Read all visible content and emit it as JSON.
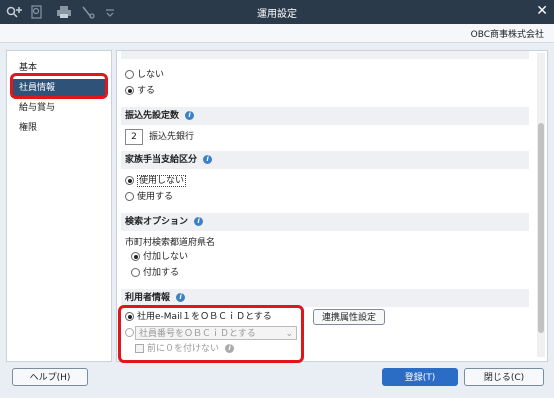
{
  "window": {
    "title": "運用設定",
    "close_glyph": "✕"
  },
  "company": "OBC商事株式会社",
  "sidebar": {
    "items": [
      {
        "label": "基本"
      },
      {
        "label": "社員情報"
      },
      {
        "label": "給与賞与"
      },
      {
        "label": "権限"
      }
    ]
  },
  "sections": {
    "auto": {
      "options": [
        "しない",
        "する"
      ],
      "selected": "する"
    },
    "transfer": {
      "title": "振込先設定数",
      "value": "2",
      "unit": "振込先銀行"
    },
    "family": {
      "title": "家族手当支給区分",
      "options": [
        "使用しない",
        "使用する"
      ],
      "selected": "使用しない"
    },
    "search": {
      "title": "検索オプション",
      "sub_label": "市町村検索都道府県名",
      "options": [
        "付加しない",
        "付加する"
      ],
      "selected": "付加しない"
    },
    "user": {
      "title": "利用者情報",
      "option1": "社用e-Mail１をＯＢＣｉＤとする",
      "option2": "社員番号をＯＢＣｉＤとする",
      "check_label": "前に０を付けない",
      "link_button": "連携属性設定"
    }
  },
  "footer": {
    "help": "ヘルプ(H)",
    "register": "登録(T)",
    "close": "閉じる(C)"
  },
  "colors": {
    "titlebar": "#2a3a4b",
    "primary": "#2b6cc4",
    "highlight": "#e0161b",
    "sidebar_active": "#2f5278"
  }
}
